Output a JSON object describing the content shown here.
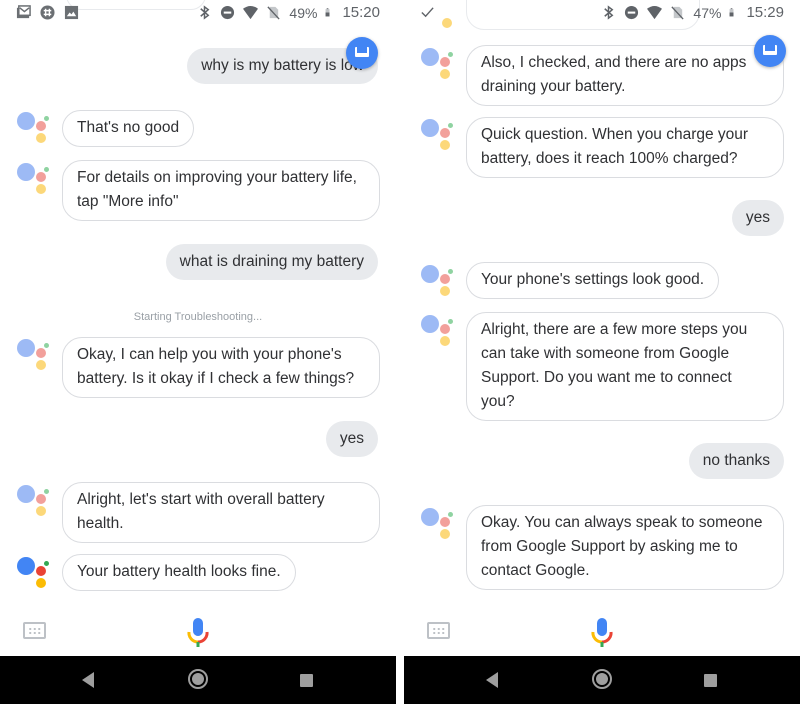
{
  "screens": [
    {
      "status_bar": {
        "left_icons": [
          "gmail-icon",
          "slack-icon",
          "gallery-icon"
        ],
        "right_icons": [
          "bluetooth-icon",
          "do-not-disturb-icon",
          "wifi-icon",
          "no-sim-icon"
        ],
        "battery_percent": "49%",
        "battery_level": 0.49,
        "time": "15:20"
      },
      "messages": [
        {
          "sender": "user",
          "text": "why is my battery is low"
        },
        {
          "sender": "assistant",
          "text": "That's no good"
        },
        {
          "sender": "assistant",
          "text": "For details on improving your battery life, tap \"More info\""
        },
        {
          "sender": "user",
          "text": "what is draining my battery"
        },
        {
          "sender": "system",
          "text": "Starting Troubleshooting..."
        },
        {
          "sender": "assistant",
          "text": "Okay, I can help you with your phone's battery. Is it okay if I check a few things?"
        },
        {
          "sender": "user",
          "text": "yes"
        },
        {
          "sender": "assistant",
          "text": "Alright, let's start with overall battery health."
        },
        {
          "sender": "assistant",
          "text": "Your battery health looks fine."
        }
      ],
      "bottom_bar": {
        "keyboard_icon": "keyboard-icon",
        "mic_icon": "mic-icon"
      },
      "nav_bar": {
        "back": "back-icon",
        "home": "home-icon",
        "recents": "recents-icon"
      }
    },
    {
      "status_bar": {
        "left_icons": [
          "check-icon"
        ],
        "right_icons": [
          "bluetooth-icon",
          "do-not-disturb-icon",
          "wifi-icon",
          "no-sim-icon"
        ],
        "battery_percent": "47%",
        "battery_level": 0.47,
        "time": "15:29"
      },
      "messages": [
        {
          "sender": "assistant",
          "text": "Also, I checked, and there are no apps draining your battery."
        },
        {
          "sender": "assistant",
          "text": "Quick question. When you charge your battery, does it reach 100% charged?"
        },
        {
          "sender": "user",
          "text": "yes"
        },
        {
          "sender": "assistant",
          "text": "Your phone's settings look good."
        },
        {
          "sender": "assistant",
          "text": "Alright, there are a few more steps you can take with someone from Google Support. Do you want me to connect you?"
        },
        {
          "sender": "user",
          "text": "no thanks"
        },
        {
          "sender": "assistant",
          "text": "Okay. You can always speak to someone from Google Support by asking me to contact Google."
        }
      ],
      "bottom_bar": {
        "keyboard_icon": "keyboard-icon",
        "mic_icon": "mic-icon"
      },
      "nav_bar": {
        "back": "back-icon",
        "home": "home-icon",
        "recents": "recents-icon"
      }
    }
  ],
  "colors": {
    "assistant_blue": "#4285f4",
    "assistant_red": "#ea4335",
    "assistant_yellow": "#fbbc05",
    "assistant_green": "#34a853",
    "user_bubble": "#e8eaed",
    "bubble_border": "#dadce0"
  }
}
